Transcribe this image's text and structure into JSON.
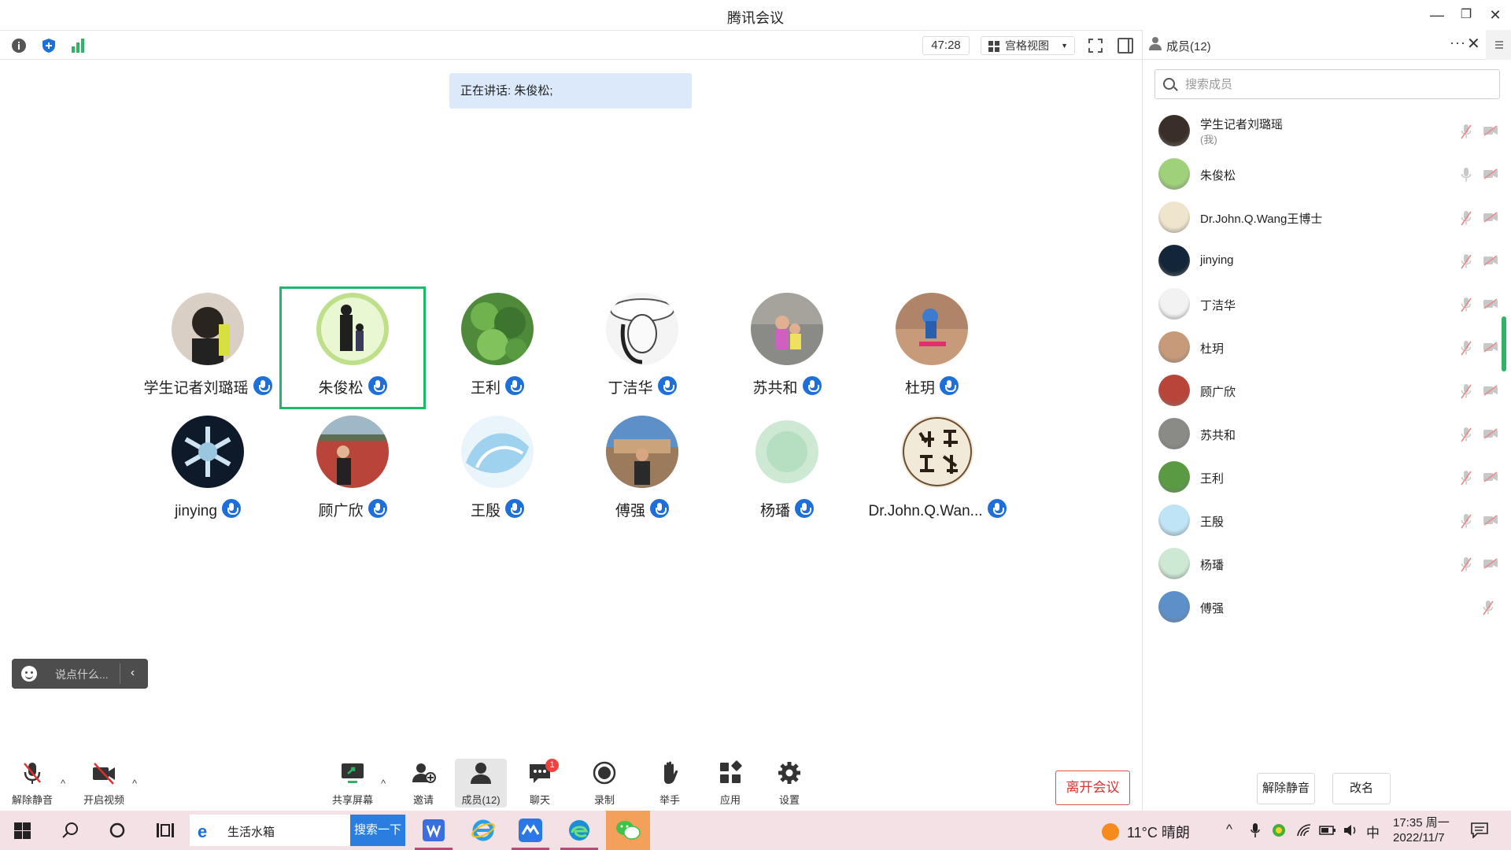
{
  "window": {
    "title": "腾讯会议",
    "minimize": "—",
    "restore": "❐",
    "close": "✕"
  },
  "toolbar": {
    "timer": "47:28",
    "view_label": "宫格视图",
    "view_caret": "▼"
  },
  "speaking": "正在讲话: 朱俊松;",
  "participants": [
    {
      "name": "学生记者刘璐瑶"
    },
    {
      "name": "朱俊松",
      "active": true
    },
    {
      "name": "王利"
    },
    {
      "name": "丁洁华"
    },
    {
      "name": "苏共和"
    },
    {
      "name": "杜玥"
    },
    {
      "name": "jinying"
    },
    {
      "name": "顾广欣"
    },
    {
      "name": "王殷"
    },
    {
      "name": "傅强"
    },
    {
      "name": "杨璠"
    },
    {
      "name": "Dr.John.Q.Wan..."
    }
  ],
  "chat_mini": {
    "placeholder": "说点什么...",
    "collapse": "‹"
  },
  "controls": {
    "unmute": "解除静音",
    "start_video": "开启视频",
    "share_screen": "共享屏幕",
    "invite": "邀请",
    "members": "成员(12)",
    "chat": "聊天",
    "chat_badge": "1",
    "record": "录制",
    "raise_hand": "举手",
    "apps": "应用",
    "settings": "设置",
    "leave": "离开会议",
    "caret": "^"
  },
  "sidebar": {
    "title": "成员(12)",
    "more": "···",
    "close": "✕",
    "search_placeholder": "搜索成员",
    "members": [
      {
        "name": "学生记者刘璐瑶",
        "sub": "(我)"
      },
      {
        "name": "朱俊松"
      },
      {
        "name": "Dr.John.Q.Wang王博士"
      },
      {
        "name": "jinying"
      },
      {
        "name": "丁洁华"
      },
      {
        "name": "杜玥"
      },
      {
        "name": "顾广欣"
      },
      {
        "name": "苏共和"
      },
      {
        "name": "王利"
      },
      {
        "name": "王殷"
      },
      {
        "name": "杨璠"
      },
      {
        "name": "傅强"
      }
    ],
    "unmute_btn": "解除静音",
    "rename_btn": "改名"
  },
  "taskbar": {
    "search_text": "生活水箱",
    "search_button": "搜索一下",
    "weather": "11°C  晴朗",
    "ime": "中",
    "time": "17:35 周一",
    "date": "2022/11/7",
    "caret": "^"
  },
  "colors": {
    "accent_blue": "#1e6fd9",
    "active_green": "#1cb96b",
    "leave_red": "#e03030",
    "taskbar_bg": "#f3e1e6"
  }
}
